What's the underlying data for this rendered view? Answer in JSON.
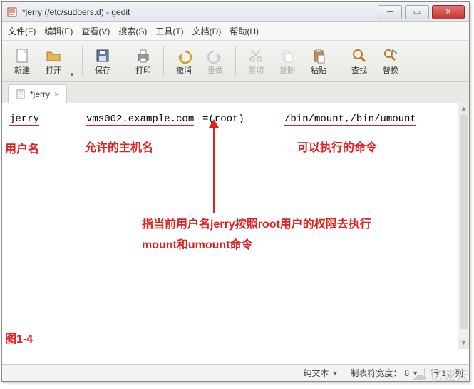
{
  "title": "*jerry (/etc/sudoers.d) - gedit",
  "menu": {
    "file": "文件(F)",
    "edit": "编辑(E)",
    "view": "查看(V)",
    "search": "搜索(S)",
    "tools": "工具(T)",
    "doc": "文档(D)",
    "help": "帮助(H)"
  },
  "toolbar": {
    "newdoc": "新建",
    "open": "打开",
    "save": "保存",
    "print": "打印",
    "undo": "撤消",
    "redo": "重做",
    "cut": "剪切",
    "copy": "复制",
    "paste": "粘贴",
    "find": "查找",
    "replace": "替换"
  },
  "tab": {
    "name": "*jerry",
    "close": "×"
  },
  "code": {
    "user": "jerry",
    "host": "vms002.example.com",
    "root": "=(root)",
    "cmds": "/bin/mount,/bin/umount"
  },
  "annotations": {
    "user_lbl": "用户名",
    "host_lbl": "允许的主机名",
    "cmd_lbl": "可以执行的命令",
    "desc": "指当前用户名jerry按照root用户的权限去执行mount和umount命令",
    "fig": "图1-4"
  },
  "status": {
    "lang": "纯文本",
    "tabwidth_label": "制表符宽度：",
    "tabwidth_value": "8",
    "pos": "行 1，列"
  },
  "watermark": "亿速云"
}
